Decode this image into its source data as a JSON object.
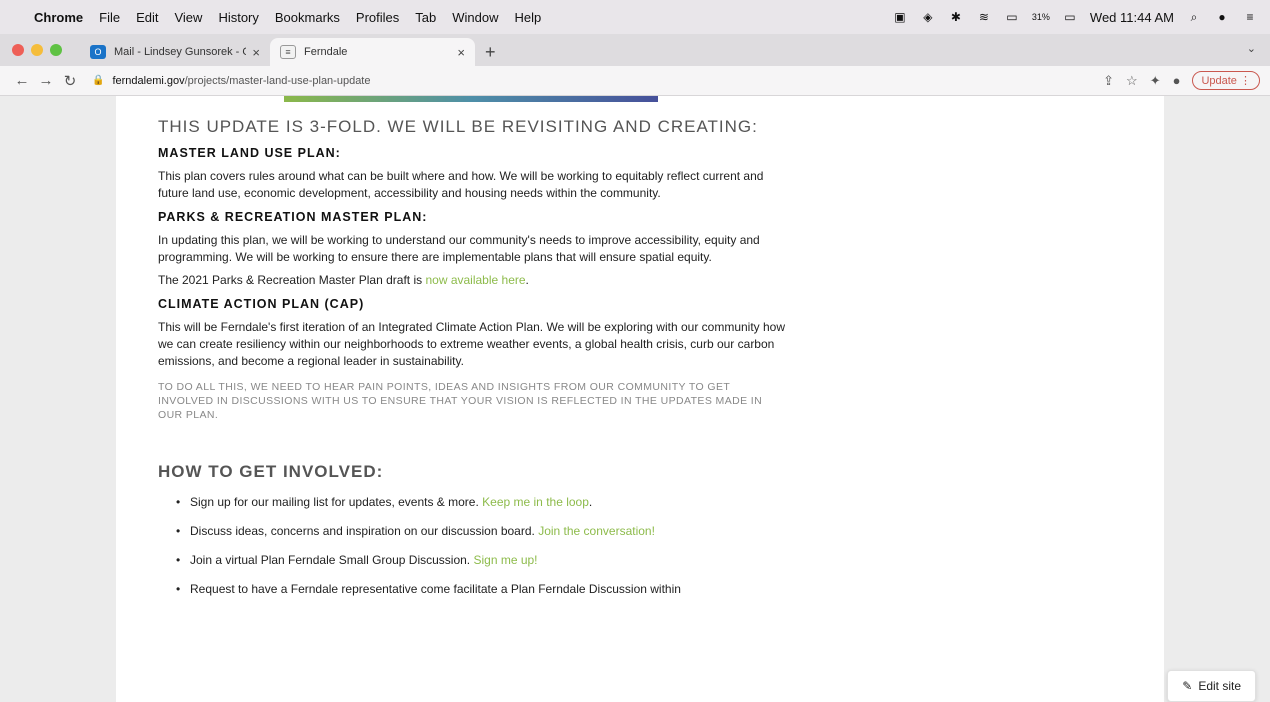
{
  "menubar": {
    "app": "Chrome",
    "items": [
      "File",
      "Edit",
      "View",
      "History",
      "Bookmarks",
      "Profiles",
      "Tab",
      "Window",
      "Help"
    ],
    "battery": "31%",
    "clock": "Wed 11:44 AM"
  },
  "tabs": [
    {
      "title": "Mail - Lindsey Gunsorek - Outl",
      "favicon_color": "#1a73c8"
    },
    {
      "title": "Ferndale",
      "favicon_color": "#f2f2f2"
    }
  ],
  "toolbar": {
    "url_host": "ferndalemi.gov",
    "url_path": "/projects/master-land-use-plan-update",
    "update_label": "Update"
  },
  "content": {
    "heading": "THIS UPDATE IS 3-FOLD. WE WILL BE REVISITING AND CREATING:",
    "s1_title": "MASTER LAND USE PLAN:",
    "s1_text": "This plan covers rules around what can be built where and how. We will be working to equitably reflect current and future land use, economic development, accessibility and housing needs within the community.",
    "s2_title": "PARKS & RECREATION MASTER PLAN:",
    "s2_text": "In updating this plan, we will be working to understand our community's needs to improve accessibility, equity and programming. We will be working to ensure there are implementable plans that will ensure spatial equity.",
    "s2_draft_text": "The 2021 Parks & Recreation Master Plan draft is ",
    "s2_draft_link": "now available here",
    "s2_draft_end": ".",
    "s3_title": "CLIMATE ACTION PLAN (CAP)",
    "s3_text": "This will be Ferndale's first iteration of an Integrated Climate Action Plan. We will be exploring with our community how we can create resiliency within our neighborhoods to extreme weather events, a global health crisis, curb our carbon emissions, and become a regional leader in sustainability.",
    "callout": "TO DO ALL THIS, WE NEED TO HEAR PAIN POINTS, IDEAS AND INSIGHTS FROM OUR COMMUNITY TO GET INVOLVED IN DISCUSSIONS WITH US TO ENSURE THAT YOUR VISION IS REFLECTED IN THE UPDATES MADE IN OUR PLAN.",
    "heading2": "HOW TO GET INVOLVED:",
    "b1_text": "Sign up for our mailing list for updates, events & more. ",
    "b1_link": "Keep me in the loop",
    "b1_end": ".",
    "b2_text": "Discuss ideas, concerns and inspiration on our discussion board. ",
    "b2_link": "Join the conversation!",
    "b3_text": "Join a virtual Plan Ferndale Small Group Discussion. ",
    "b3_link": "Sign me up!",
    "b4_text": "Request to have a Ferndale representative come facilitate a Plan Ferndale Discussion within"
  },
  "edit_site": "Edit site"
}
